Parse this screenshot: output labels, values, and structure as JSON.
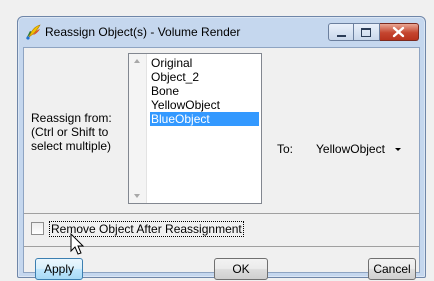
{
  "window": {
    "title": "Reassign Object(s) - Volume Render"
  },
  "form": {
    "reassign_from_line1": "Reassign from:",
    "reassign_from_line2": "(Ctrl or Shift to",
    "reassign_from_line3": "select multiple)",
    "objects": [
      "Original",
      "Object_2",
      "Bone",
      "YellowObject",
      "BlueObject"
    ],
    "selected_object": "BlueObject",
    "to_label": "To:",
    "to_value": "YellowObject",
    "remove_checkbox_label": "Remove Object After Reassignment",
    "remove_checked": false
  },
  "buttons": {
    "apply": "Apply",
    "ok": "OK",
    "cancel": "Cancel"
  },
  "colors": {
    "selection": "#3399ff",
    "close_button": "#c5452f"
  },
  "icons": {
    "app": "volume-render-app-icon",
    "minimize": "minimize-icon",
    "maximize": "maximize-icon",
    "close": "close-icon",
    "cursor": "mouse-pointer-icon"
  }
}
